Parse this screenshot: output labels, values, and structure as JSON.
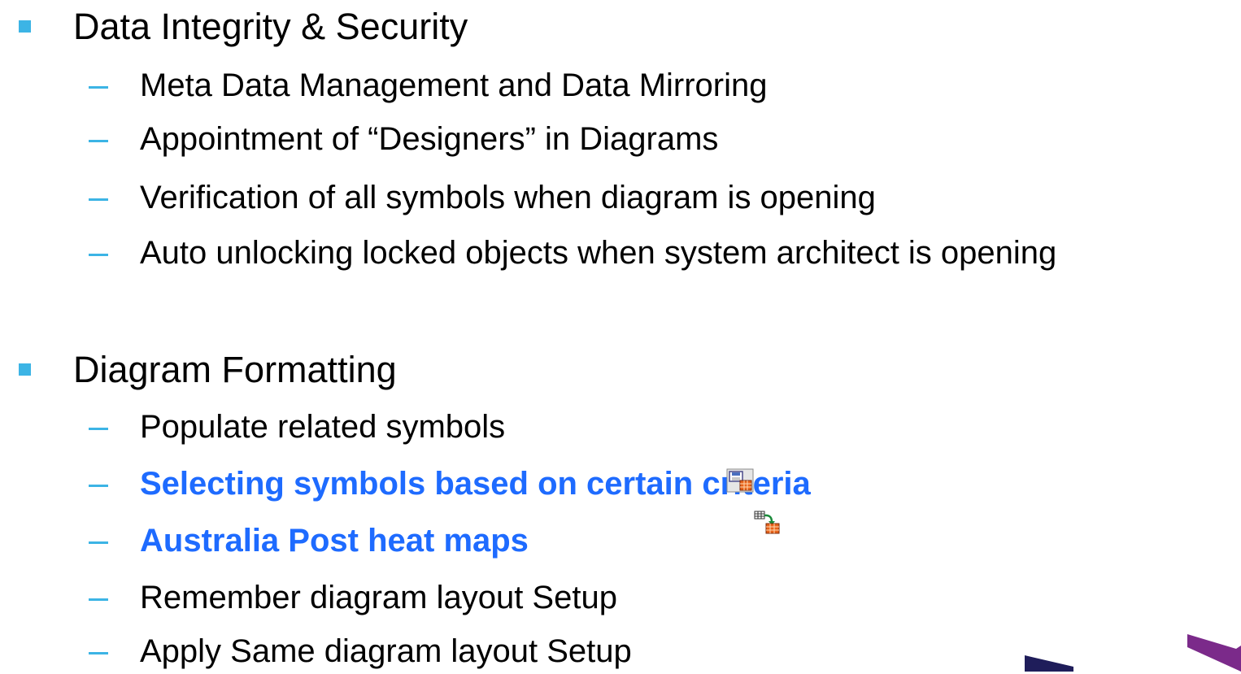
{
  "sections": [
    {
      "heading": "Data Integrity & Security",
      "items": [
        "Meta Data Management and Data Mirroring",
        "Appointment of “Designers” in Diagrams",
        "Verification of all symbols when diagram is opening",
        "Auto unlocking locked objects when system architect is opening"
      ]
    },
    {
      "heading": "Diagram Formatting",
      "items": [
        "Populate related symbols",
        "Selecting symbols based on certain criteria",
        "Australia Post heat maps",
        "Remember diagram layout Setup",
        "Apply Same diagram layout Setup"
      ]
    }
  ],
  "icons": {
    "selection_icon": "table-save-icon",
    "heatmap_icon": "table-export-icon"
  },
  "colors": {
    "bullet": "#3cb4e5",
    "highlight_text": "#1e6bff",
    "corner_navy": "#1f1d5a",
    "corner_purple": "#7b2a8a"
  }
}
